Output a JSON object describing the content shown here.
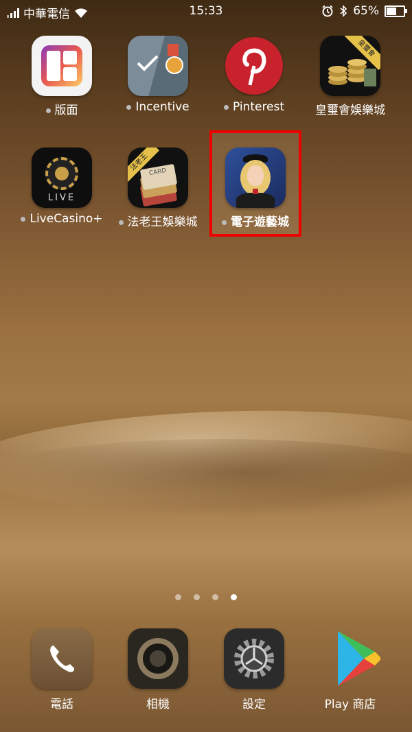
{
  "status_bar": {
    "carrier": "中華電信",
    "time": "15:33",
    "battery_percent": "65%",
    "battery_level": 0.65,
    "icons": [
      "signal-icon",
      "wifi-icon",
      "alarm-icon",
      "bluetooth-icon",
      "battery-icon"
    ]
  },
  "apps": [
    {
      "name": "版面",
      "icon": "layout-icon",
      "new": true
    },
    {
      "name": "Incentive",
      "icon": "incentive-icon",
      "new": true
    },
    {
      "name": "Pinterest",
      "icon": "pinterest-icon",
      "new": true
    },
    {
      "name": "皇璽會娛樂城",
      "icon": "coins-icon",
      "new": false
    },
    {
      "name": "LiveCasino+",
      "icon": "poker-chip-icon",
      "new": true
    },
    {
      "name": "法老王娛樂城",
      "icon": "cards-icon",
      "new": true
    },
    {
      "name": "電子遊藝城",
      "icon": "character-icon",
      "new": true,
      "highlighted": true
    }
  ],
  "badges": {
    "coins_badge": "皇璽會",
    "cards_badge": "法老王",
    "live_text": "LIVE",
    "card_text": "CARD"
  },
  "page_indicator": {
    "pages": 4,
    "current": 4
  },
  "dock": [
    {
      "name": "電話",
      "icon": "phone-icon"
    },
    {
      "name": "相機",
      "icon": "camera-icon"
    },
    {
      "name": "設定",
      "icon": "settings-gear-icon"
    },
    {
      "name": "Play 商店",
      "icon": "play-store-icon"
    }
  ],
  "colors": {
    "highlight": "#e00000",
    "pinterest": "#c8232c"
  }
}
